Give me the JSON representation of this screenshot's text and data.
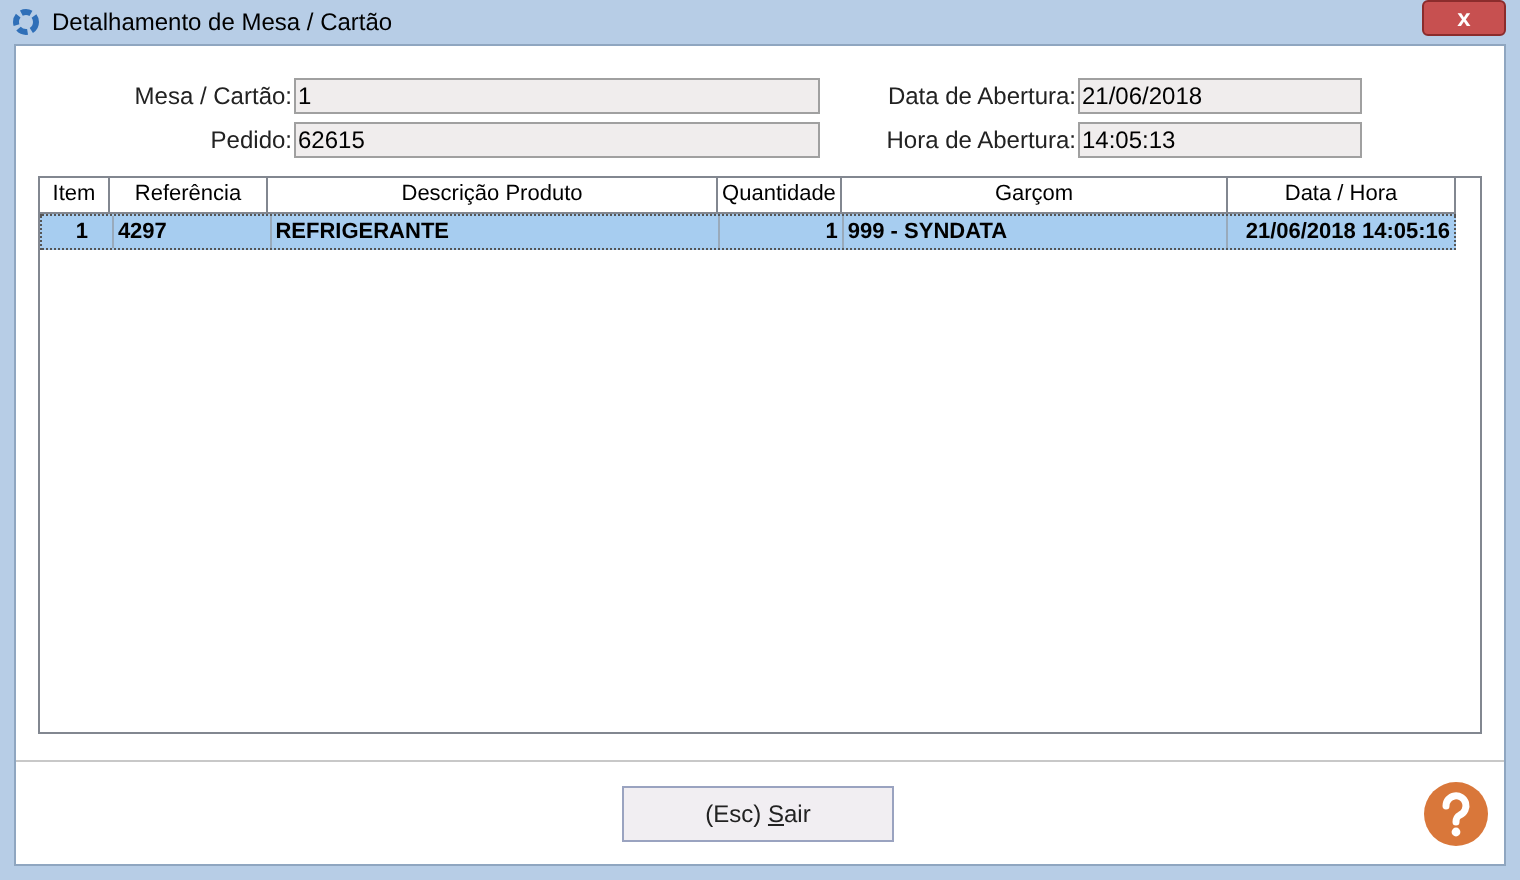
{
  "window": {
    "title": "Detalhamento de Mesa / Cartão",
    "close": "x"
  },
  "fields_left": [
    {
      "label": "Mesa / Cartão:",
      "value": "1"
    },
    {
      "label": "Pedido:",
      "value": "62615"
    }
  ],
  "fields_right": [
    {
      "label": "Data de Abertura:",
      "value": "21/06/2018"
    },
    {
      "label": "Hora de Abertura:",
      "value": "14:05:13"
    }
  ],
  "table": {
    "columns": [
      {
        "label": "Item"
      },
      {
        "label": "Referência"
      },
      {
        "label": "Descrição Produto"
      },
      {
        "label": "Quantidade"
      },
      {
        "label": "Garçom"
      },
      {
        "label": "Data / Hora"
      }
    ],
    "rows": [
      {
        "selected": true,
        "cells": [
          "1",
          "4297",
          "REFRIGERANTE",
          "1",
          "999 - SYNDATA",
          "21/06/2018 14:05:16"
        ]
      }
    ]
  },
  "exit_button": {
    "before": "(Esc) ",
    "mnemonic": "S",
    "after": "air"
  }
}
